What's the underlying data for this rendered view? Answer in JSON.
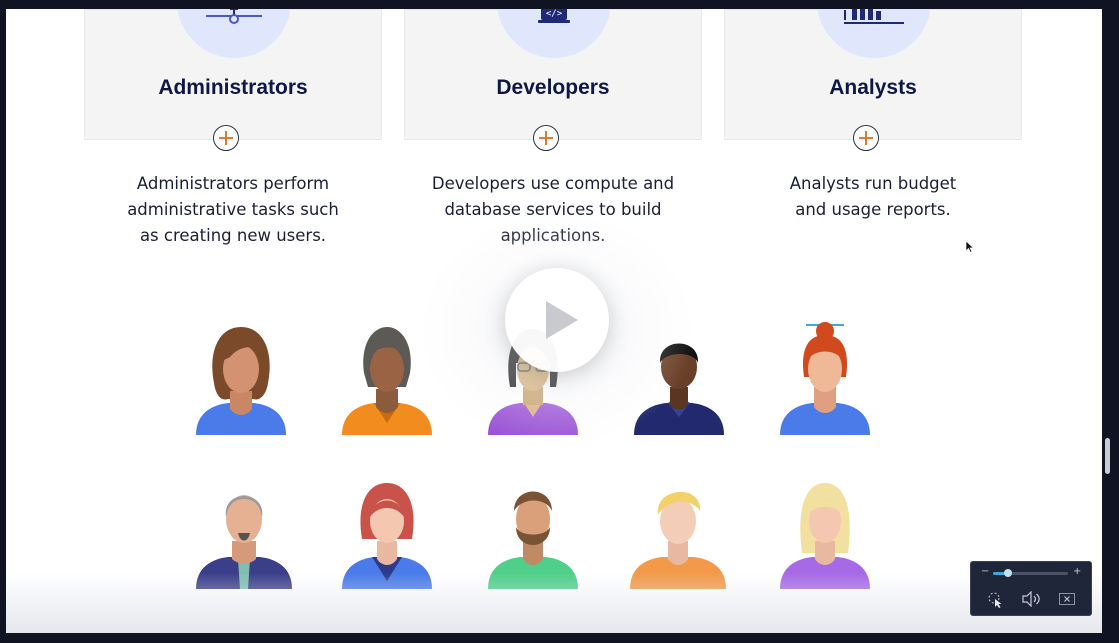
{
  "cards": [
    {
      "title": "Administrators",
      "icon": "network-icon",
      "description": [
        "Administrators perform",
        "administrative tasks such",
        "as creating new users."
      ]
    },
    {
      "title": "Developers",
      "icon": "code-laptop-icon",
      "description": [
        "Developers use compute and",
        "database services to build",
        "applications."
      ]
    },
    {
      "title": "Analysts",
      "icon": "bar-chart-icon",
      "description": [
        "Analysts run budget",
        "and usage reports."
      ]
    }
  ],
  "colors": {
    "heading": "#0f1747",
    "accent_orange": "#e8772e",
    "card_bg": "#f4f4f5",
    "icon_circle": "#e0e6fb",
    "icon_navy": "#1e2a78",
    "player_bg": "#20263a"
  },
  "player": {
    "volume_fraction": 0.2,
    "play_icon": "play-icon"
  }
}
